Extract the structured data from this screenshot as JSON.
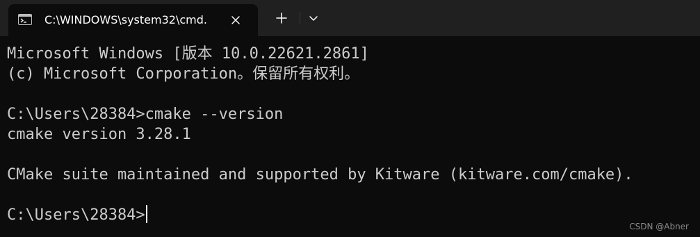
{
  "tab": {
    "title": "C:\\WINDOWS\\system32\\cmd.",
    "icon": "terminal-icon"
  },
  "toolbar": {
    "close_icon": "close-icon",
    "new_tab_icon": "plus-icon",
    "dropdown_icon": "chevron-down-icon"
  },
  "console": {
    "lines": [
      "Microsoft Windows [版本 10.0.22621.2861]",
      "(c) Microsoft Corporation。保留所有权利。",
      "",
      "C:\\Users\\28384>cmake --version",
      "cmake version 3.28.1",
      "",
      "CMake suite maintained and supported by Kitware (kitware.com/cmake).",
      "",
      "C:\\Users\\28384>"
    ]
  },
  "watermark": "CSDN @Abner",
  "colors": {
    "titlebar_bg": "#202020",
    "console_bg": "#0c0c0c",
    "text": "#cccccc"
  }
}
